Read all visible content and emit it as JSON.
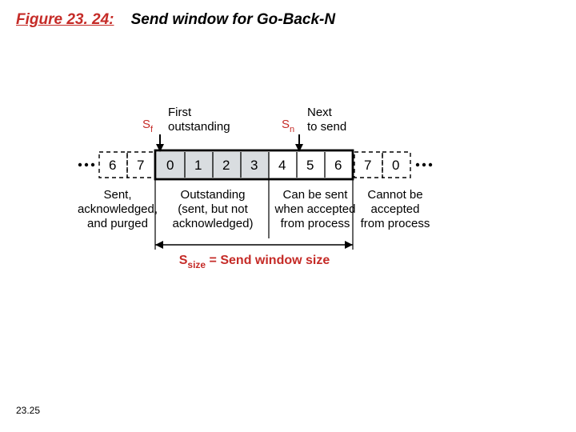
{
  "figure": {
    "number": "Figure 23. 24:",
    "caption": "Send window for Go-Back-N",
    "page": "23.25"
  },
  "pointers": {
    "sf": "S",
    "sf_sub": "f",
    "sf_text1": "First",
    "sf_text2": "outstanding",
    "sn": "S",
    "sn_sub": "n",
    "sn_text1": "Next",
    "sn_text2": "to send"
  },
  "regions": {
    "r1a": "Sent,",
    "r1b": "acknowledged,",
    "r1c": "and purged",
    "r2a": "Outstanding",
    "r2b": "(sent, but not",
    "r2c": "acknowledged)",
    "r3a": "Can be sent",
    "r3b": "when accepted",
    "r3c": "from process",
    "r4a": "Cannot be",
    "r4b": "accepted",
    "r4c": "from process"
  },
  "size_label": {
    "s": "S",
    "sub": "size",
    "rest": " = Send window size"
  },
  "cells": {
    "left": [
      "6",
      "7"
    ],
    "outstanding": [
      "0",
      "1",
      "2",
      "3"
    ],
    "cansend": [
      "4",
      "5",
      "6"
    ],
    "right": [
      "7",
      "0"
    ]
  }
}
